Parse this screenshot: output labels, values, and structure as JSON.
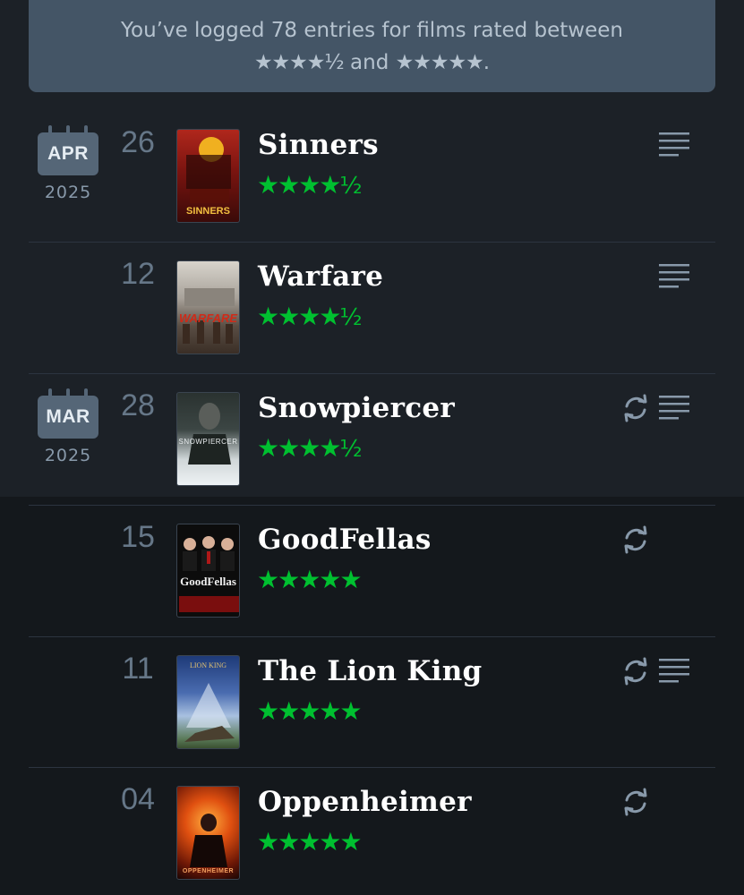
{
  "summary": {
    "line1": "You’ve logged 78 entries for films rated between",
    "range_low": "★★★★½",
    "and_text": " and ",
    "range_high": "★★★★★",
    "period": "."
  },
  "colors": {
    "background": "#14181c",
    "banner": "#445566",
    "star_green": "#00c030",
    "calendar": "#556677"
  },
  "entries": [
    {
      "month": "APR",
      "year": "2025",
      "day": "26",
      "title": "Sinners",
      "rating": "★★★★",
      "half": "½",
      "rewatch": false,
      "review": true,
      "poster_label": "SINNERS"
    },
    {
      "month": "",
      "year": "",
      "day": "12",
      "title": "Warfare",
      "rating": "★★★★",
      "half": "½",
      "rewatch": false,
      "review": true,
      "poster_label": "WARFARE"
    },
    {
      "month": "MAR",
      "year": "2025",
      "day": "28",
      "title": "Snowpiercer",
      "rating": "★★★★",
      "half": "½",
      "rewatch": true,
      "review": true,
      "poster_label": "SNOWPIERCER"
    },
    {
      "month": "",
      "year": "",
      "day": "15",
      "title": "GoodFellas",
      "rating": "★★★★★",
      "half": "",
      "rewatch": true,
      "review": false,
      "poster_label": "GoodFellas"
    },
    {
      "month": "",
      "year": "",
      "day": "11",
      "title": "The Lion King",
      "rating": "★★★★★",
      "half": "",
      "rewatch": true,
      "review": true,
      "poster_label": "LION KING"
    },
    {
      "month": "",
      "year": "",
      "day": "04",
      "title": "Oppenheimer",
      "rating": "★★★★★",
      "half": "",
      "rewatch": true,
      "review": false,
      "poster_label": "OPPENHEIMER"
    }
  ],
  "icons": {
    "review": "review-lines-icon",
    "rewatch": "rewatch-icon",
    "calendar": "calendar-icon"
  }
}
